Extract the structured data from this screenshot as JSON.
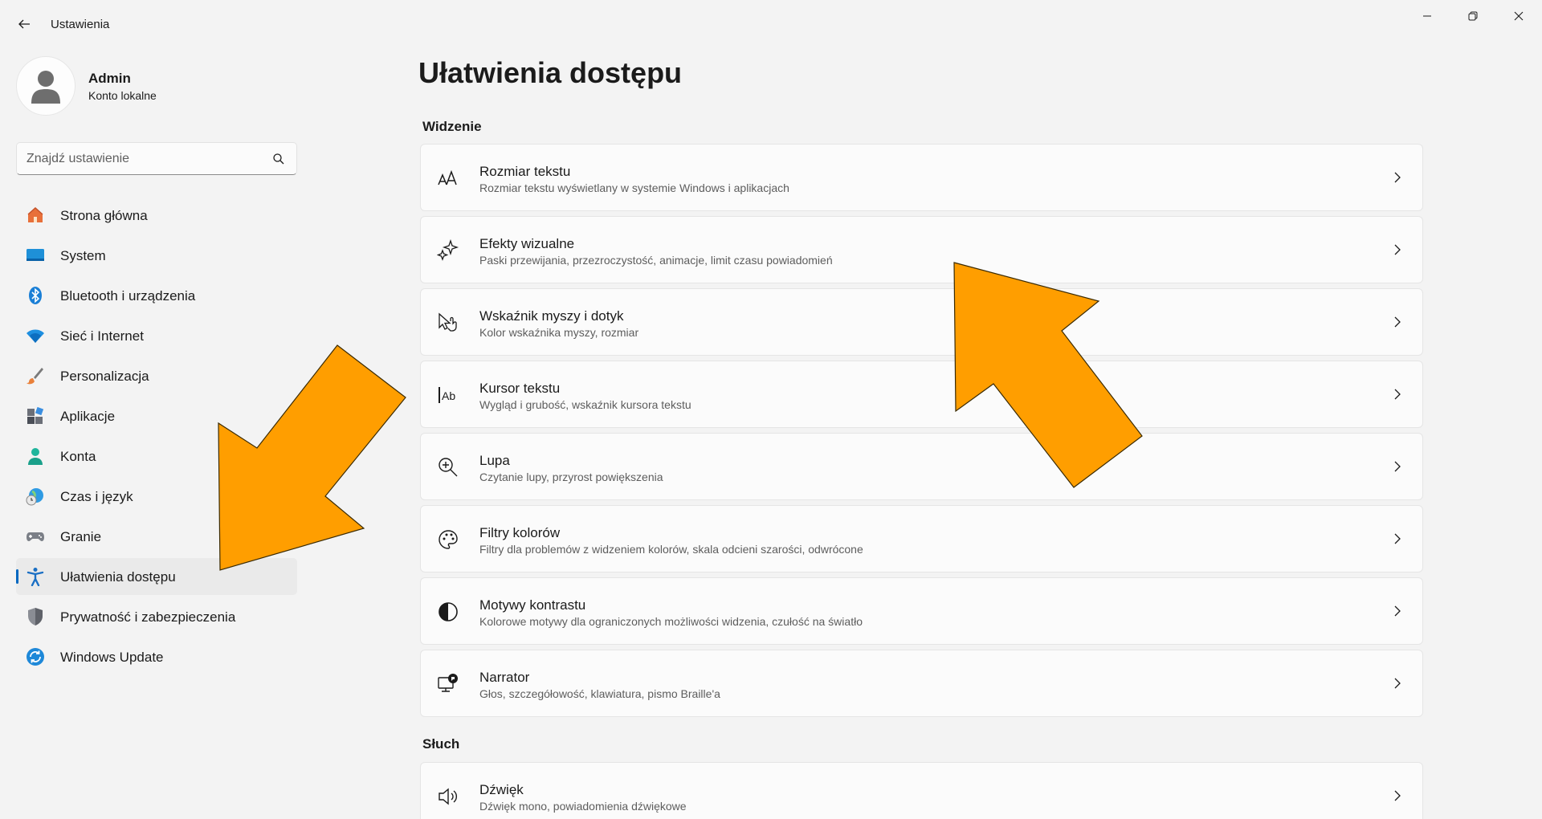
{
  "window": {
    "title": "Ustawienia"
  },
  "user": {
    "name": "Admin",
    "account_type": "Konto lokalne"
  },
  "search": {
    "placeholder": "Znajdź ustawienie",
    "value": ""
  },
  "sidebar": {
    "items": [
      {
        "label": "Strona główna",
        "icon": "home-icon"
      },
      {
        "label": "System",
        "icon": "system-icon"
      },
      {
        "label": "Bluetooth i urządzenia",
        "icon": "bluetooth-icon"
      },
      {
        "label": "Sieć i Internet",
        "icon": "wifi-icon"
      },
      {
        "label": "Personalizacja",
        "icon": "brush-icon"
      },
      {
        "label": "Aplikacje",
        "icon": "apps-icon"
      },
      {
        "label": "Konta",
        "icon": "account-icon"
      },
      {
        "label": "Czas i język",
        "icon": "globe-clock-icon"
      },
      {
        "label": "Granie",
        "icon": "gamepad-icon"
      },
      {
        "label": "Ułatwienia dostępu",
        "icon": "accessibility-icon",
        "selected": true
      },
      {
        "label": "Prywatność i zabezpieczenia",
        "icon": "shield-icon"
      },
      {
        "label": "Windows Update",
        "icon": "windows-update-icon"
      }
    ]
  },
  "main": {
    "title": "Ułatwienia dostępu",
    "sections": [
      {
        "title": "Widzenie",
        "cards": [
          {
            "title": "Rozmiar tekstu",
            "desc": "Rozmiar tekstu wyświetlany w systemie Windows i aplikacjach",
            "icon": "text-size-icon"
          },
          {
            "title": "Efekty wizualne",
            "desc": "Paski przewijania, przezroczystość, animacje, limit czasu powiadomień",
            "icon": "sparkle-icon"
          },
          {
            "title": "Wskaźnik myszy i dotyk",
            "desc": "Kolor wskaźnika myszy, rozmiar",
            "icon": "mouse-pointer-icon"
          },
          {
            "title": "Kursor tekstu",
            "desc": "Wygląd i grubość, wskaźnik kursora tekstu",
            "icon": "text-cursor-icon"
          },
          {
            "title": "Lupa",
            "desc": "Czytanie lupy, przyrost powiększenia",
            "icon": "magnifier-icon"
          },
          {
            "title": "Filtry kolorów",
            "desc": "Filtry dla problemów z widzeniem kolorów, skala odcieni szarości, odwrócone",
            "icon": "palette-icon"
          },
          {
            "title": "Motywy kontrastu",
            "desc": "Kolorowe motywy dla ograniczonych możliwości widzenia, czułość na światło",
            "icon": "contrast-icon"
          },
          {
            "title": "Narrator",
            "desc": "Głos, szczegółowość, klawiatura, pismo Braille'a",
            "icon": "narrator-icon"
          }
        ]
      },
      {
        "title": "Słuch",
        "cards": [
          {
            "title": "Dźwięk",
            "desc": "Dźwięk mono, powiadomienia dźwiękowe",
            "icon": "speaker-icon"
          }
        ]
      }
    ]
  },
  "colors": {
    "accent": "#0067c0",
    "annotation_arrow": "#ff9e00"
  }
}
